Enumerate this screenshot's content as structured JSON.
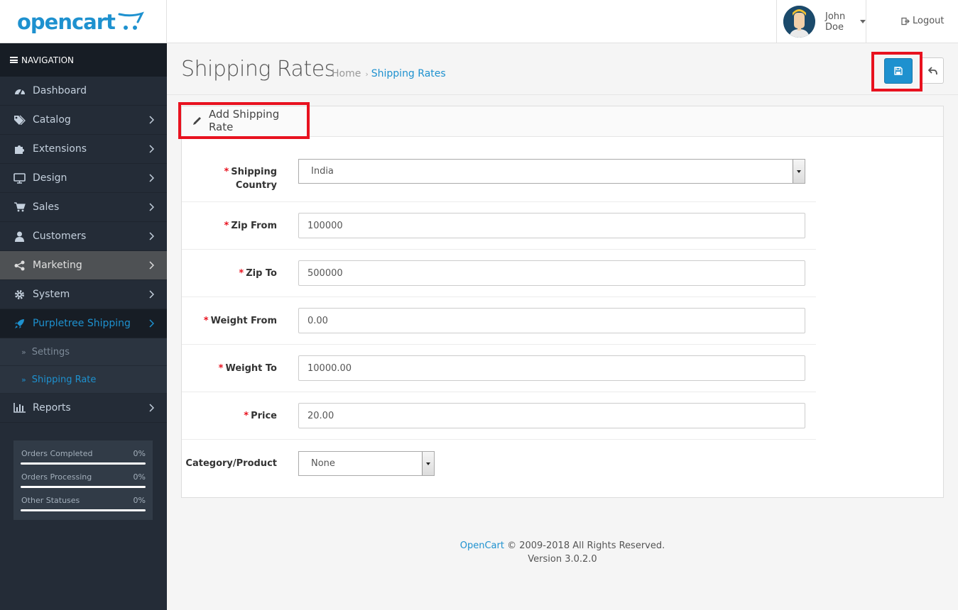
{
  "header": {
    "logo_text": "opencart",
    "user_name": "John Doe",
    "logout_label": "Logout"
  },
  "sidebar": {
    "nav_header": "NAVIGATION",
    "items": [
      {
        "label": "Dashboard",
        "icon": "dashboard-icon"
      },
      {
        "label": "Catalog",
        "icon": "tags-icon"
      },
      {
        "label": "Extensions",
        "icon": "puzzle-icon"
      },
      {
        "label": "Design",
        "icon": "monitor-icon"
      },
      {
        "label": "Sales",
        "icon": "cart-icon"
      },
      {
        "label": "Customers",
        "icon": "user-icon"
      },
      {
        "label": "Marketing",
        "icon": "share-icon"
      },
      {
        "label": "System",
        "icon": "gear-icon"
      },
      {
        "label": "Purpletree Shipping",
        "icon": "rocket-icon"
      }
    ],
    "sub_items": [
      {
        "label": "Settings"
      },
      {
        "label": "Shipping Rate"
      }
    ],
    "reports_label": "Reports",
    "stats": [
      {
        "label": "Orders Completed",
        "value": "0%"
      },
      {
        "label": "Orders Processing",
        "value": "0%"
      },
      {
        "label": "Other Statuses",
        "value": "0%"
      }
    ]
  },
  "page": {
    "title": "Shipping Rates",
    "breadcrumb_home": "Home",
    "breadcrumb_current": "Shipping Rates",
    "breadcrumb_sep": "›"
  },
  "panel": {
    "title": "Add Shipping Rate",
    "fields": {
      "country_label_1": "Shipping",
      "country_label_2": "Country",
      "country_value": "India",
      "zip_from_label": "Zip From",
      "zip_from_value": "100000",
      "zip_to_label": "Zip To",
      "zip_to_value": "500000",
      "weight_from_label": "Weight From",
      "weight_from_value": "0.00",
      "weight_to_label": "Weight To",
      "weight_to_value": "10000.00",
      "price_label": "Price",
      "price_value": "20.00",
      "category_label": "Category/Product",
      "category_value": "None"
    },
    "required_mark": "*"
  },
  "footer": {
    "brand_link": "OpenCart",
    "copyright": "© 2009-2018 All Rights Reserved.",
    "version": "Version 3.0.2.0"
  },
  "colors": {
    "accent": "#1e91cf",
    "sidebar_bg": "#242c37",
    "highlight": "#e8121f"
  }
}
